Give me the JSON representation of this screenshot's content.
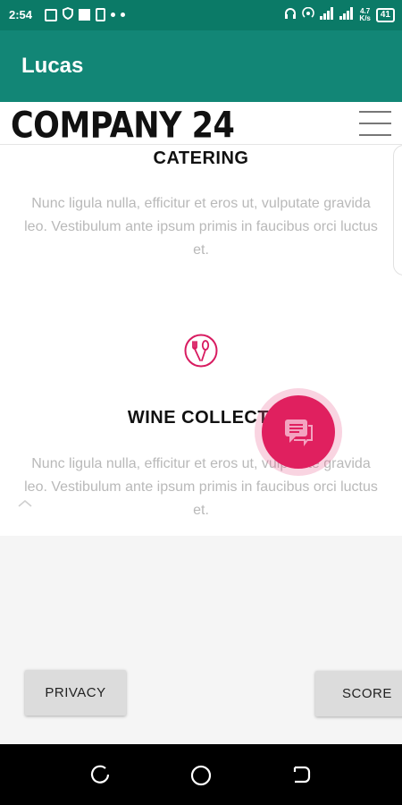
{
  "status_bar": {
    "time": "2:54",
    "network_speed_top": "4.7",
    "network_speed_bottom": "K/s",
    "battery": "41"
  },
  "app_bar": {
    "title": "Lucas"
  },
  "site_header": {
    "logo_text": "COMPANY 24"
  },
  "sections": [
    {
      "heading": "CATERING",
      "text": "Nunc ligula nulla, efficitur et eros ut, vulputate gravida leo. Vestibulum ante ipsum primis in faucibus orci luctus et."
    },
    {
      "heading": "WINE COLLECTI",
      "text": "Nunc ligula nulla, efficitur et eros ut, vulputate gravida leo. Vestibulum ante ipsum primis in faucibus orci luctus et."
    }
  ],
  "buttons": {
    "privacy": "PRIVACY",
    "score": "SCORE"
  },
  "colors": {
    "status_bar": "#0b7a67",
    "app_bar": "#128676",
    "fab": "#e0205f",
    "accent_icon": "#d81b60"
  },
  "icons": {
    "section_icon": "fork-spoon-icon",
    "fab_icon": "chat-icon",
    "scroll_top": "chevron-up-icon",
    "nav_back": "back-icon",
    "nav_home": "home-icon",
    "nav_recent": "recent-apps-icon"
  }
}
